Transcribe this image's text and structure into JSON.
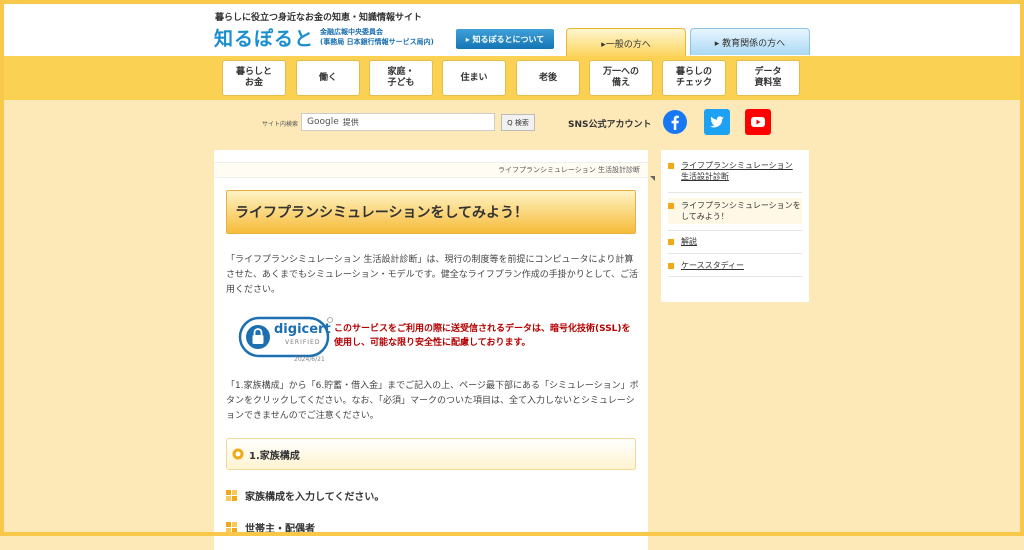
{
  "header": {
    "tagline": "暮らしに役立つ身近なお金の知恵・知識情報サイト",
    "logo_main": "知るぽると",
    "org_line1": "金融広報中央委員会",
    "org_line2": "(事務局 日本銀行情報サービス局内)",
    "about_button": "▸ 知るぽるとについて",
    "tab_general": "▸一般の方へ",
    "tab_education": "▸ 教育関係の方へ"
  },
  "nav": {
    "items": [
      {
        "label": "暮らしと\nお金"
      },
      {
        "label": "働く"
      },
      {
        "label": "家庭・\n子ども"
      },
      {
        "label": "住まい"
      },
      {
        "label": "老後"
      },
      {
        "label": "万一への\n備え"
      },
      {
        "label": "暮らしの\nチェック"
      },
      {
        "label": "データ\n資料室"
      }
    ]
  },
  "search": {
    "label": "サイト内検索",
    "google": "Google",
    "placeholder": "提供",
    "button": "Q 検索"
  },
  "sns": {
    "label": "SNS公式アカウント",
    "accounts": [
      "facebook-icon",
      "twitter-icon",
      "youtube-icon"
    ],
    "colors": {
      "facebook": "#1877f2",
      "twitter": "#1da1f2",
      "youtube": "#ff0000"
    }
  },
  "main": {
    "breadcrumb": "ライフプランシミュレーション 生活設計診断",
    "title": "ライフプランシミュレーションをしてみよう！",
    "intro": "「ライフプランシミュレーション 生活設計診断」は、現行の制度等を前提にコンピュータにより計算させた、あくまでもシミュレーション・モデルです。健全なライフプラン作成の手掛かりとして、ご活用ください。",
    "ssl_brand": "digicert",
    "ssl_verified": "VERIFIED",
    "ssl_date": "2024/6/21",
    "ssl_notice": "このサービスをご利用の際に送受信されるデータは、暗号化技術(SSL)を使用し、可能な限り安全性に配慮しております。",
    "instructions": "「1.家族構成」から「6.貯蓄・借入金」までご記入の上、ページ最下部にある「シミュレーション」ボタンをクリックしてください。なお、「必須」マークのついた項目は、全て入力しないとシミュレーションできませんのでご注意ください。",
    "section1": "1.家族構成",
    "sub1": "家族構成を入力してください。",
    "sub2": "世帯主・配偶者"
  },
  "sidebar": {
    "items": [
      {
        "label": "ライフプランシミュレーション 生活設計診断"
      },
      {
        "label": "ライフプランシミュレーションをしてみよう！"
      },
      {
        "label": "解説"
      },
      {
        "label": "ケーススタディー"
      }
    ]
  },
  "colors": {
    "accent_yellow": "#fbd154",
    "page_bg": "#fde9b8",
    "ssl_red": "#b40000",
    "sidebar_marker": "#f2a918"
  }
}
